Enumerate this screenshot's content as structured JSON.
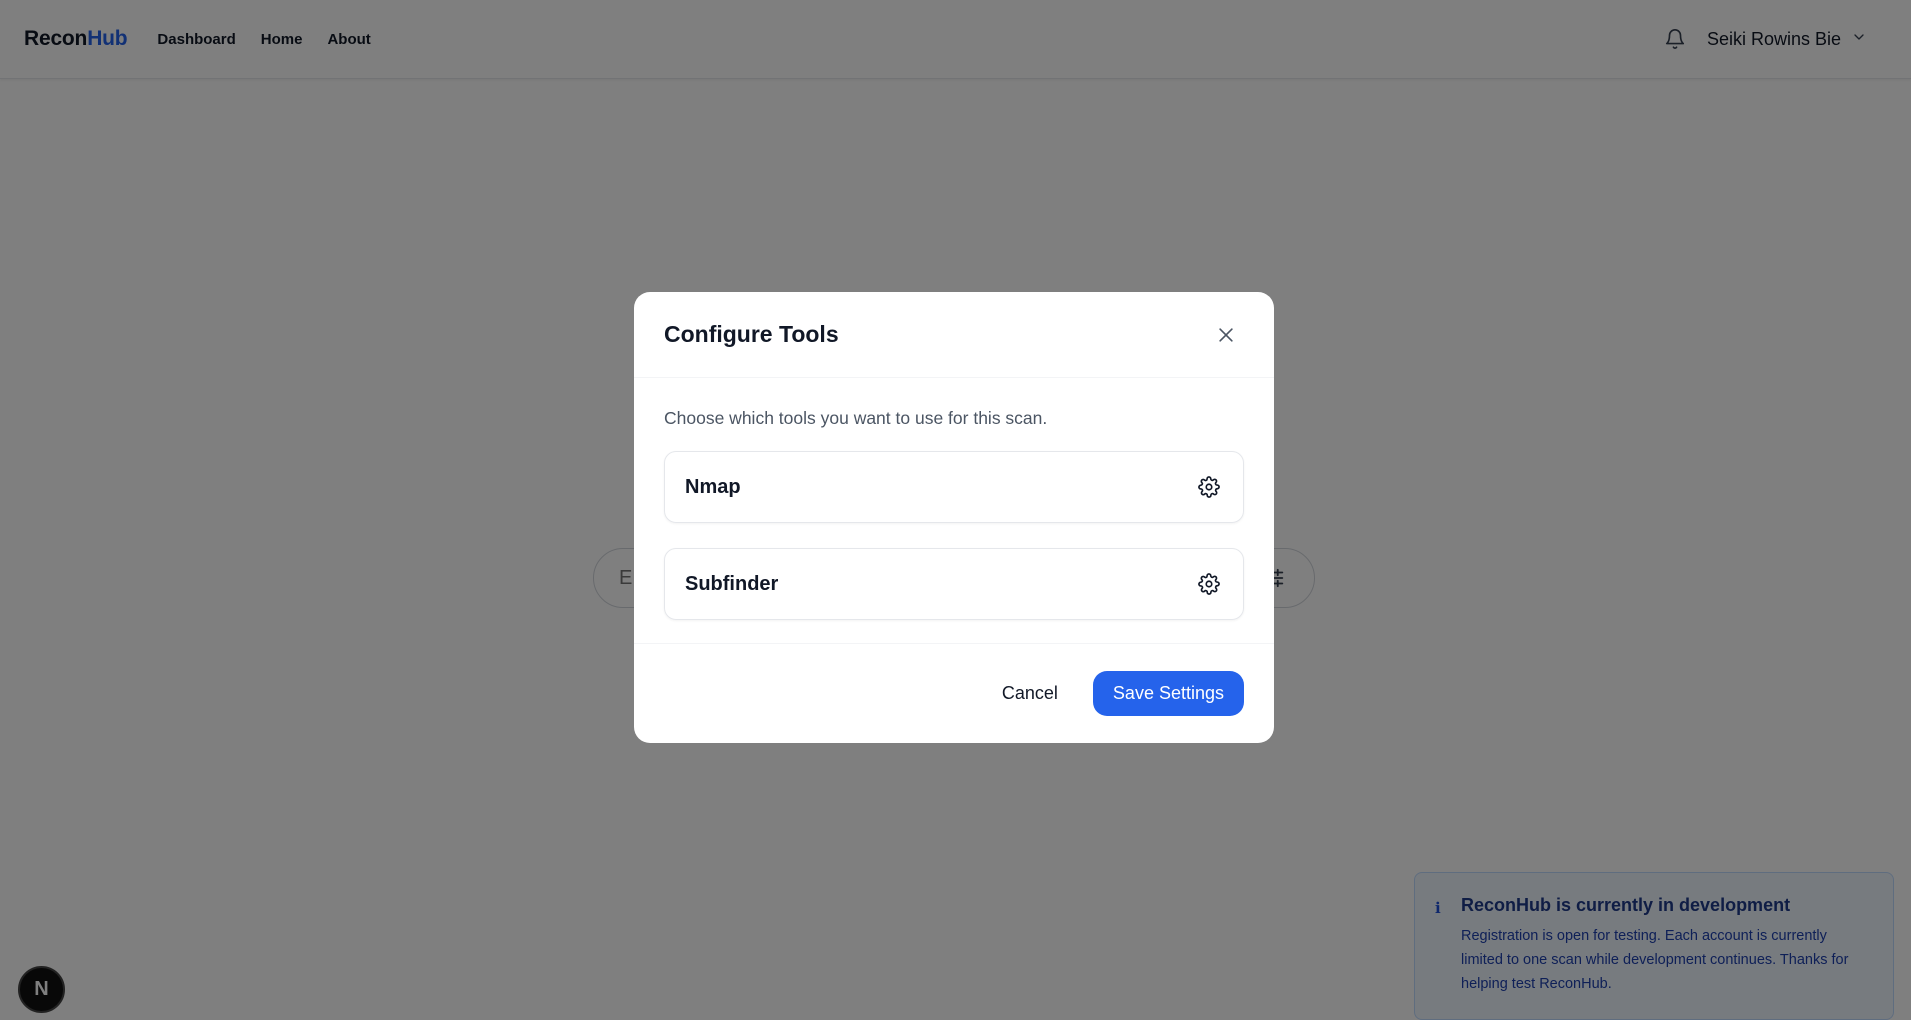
{
  "nav": {
    "logo_part_a": "Recon",
    "logo_part_b": "Hub",
    "links": [
      "Dashboard",
      "Home",
      "About"
    ],
    "user_name": "Seiki Rowins Bie"
  },
  "search": {
    "placeholder": "E"
  },
  "modal": {
    "title": "Configure Tools",
    "description": "Choose which tools you want to use for this scan.",
    "tools": [
      "Nmap",
      "Subfinder"
    ],
    "cancel_label": "Cancel",
    "save_label": "Save Settings"
  },
  "toast": {
    "icon": "ℹ",
    "title": "ReconHub is currently in development",
    "body": "Registration is open for testing. Each account is currently limited to one scan while development continues. Thanks for helping test ReconHub."
  },
  "badge": {
    "letter": "N"
  },
  "colors": {
    "accent": "#2563eb",
    "overlay": "#000000"
  }
}
